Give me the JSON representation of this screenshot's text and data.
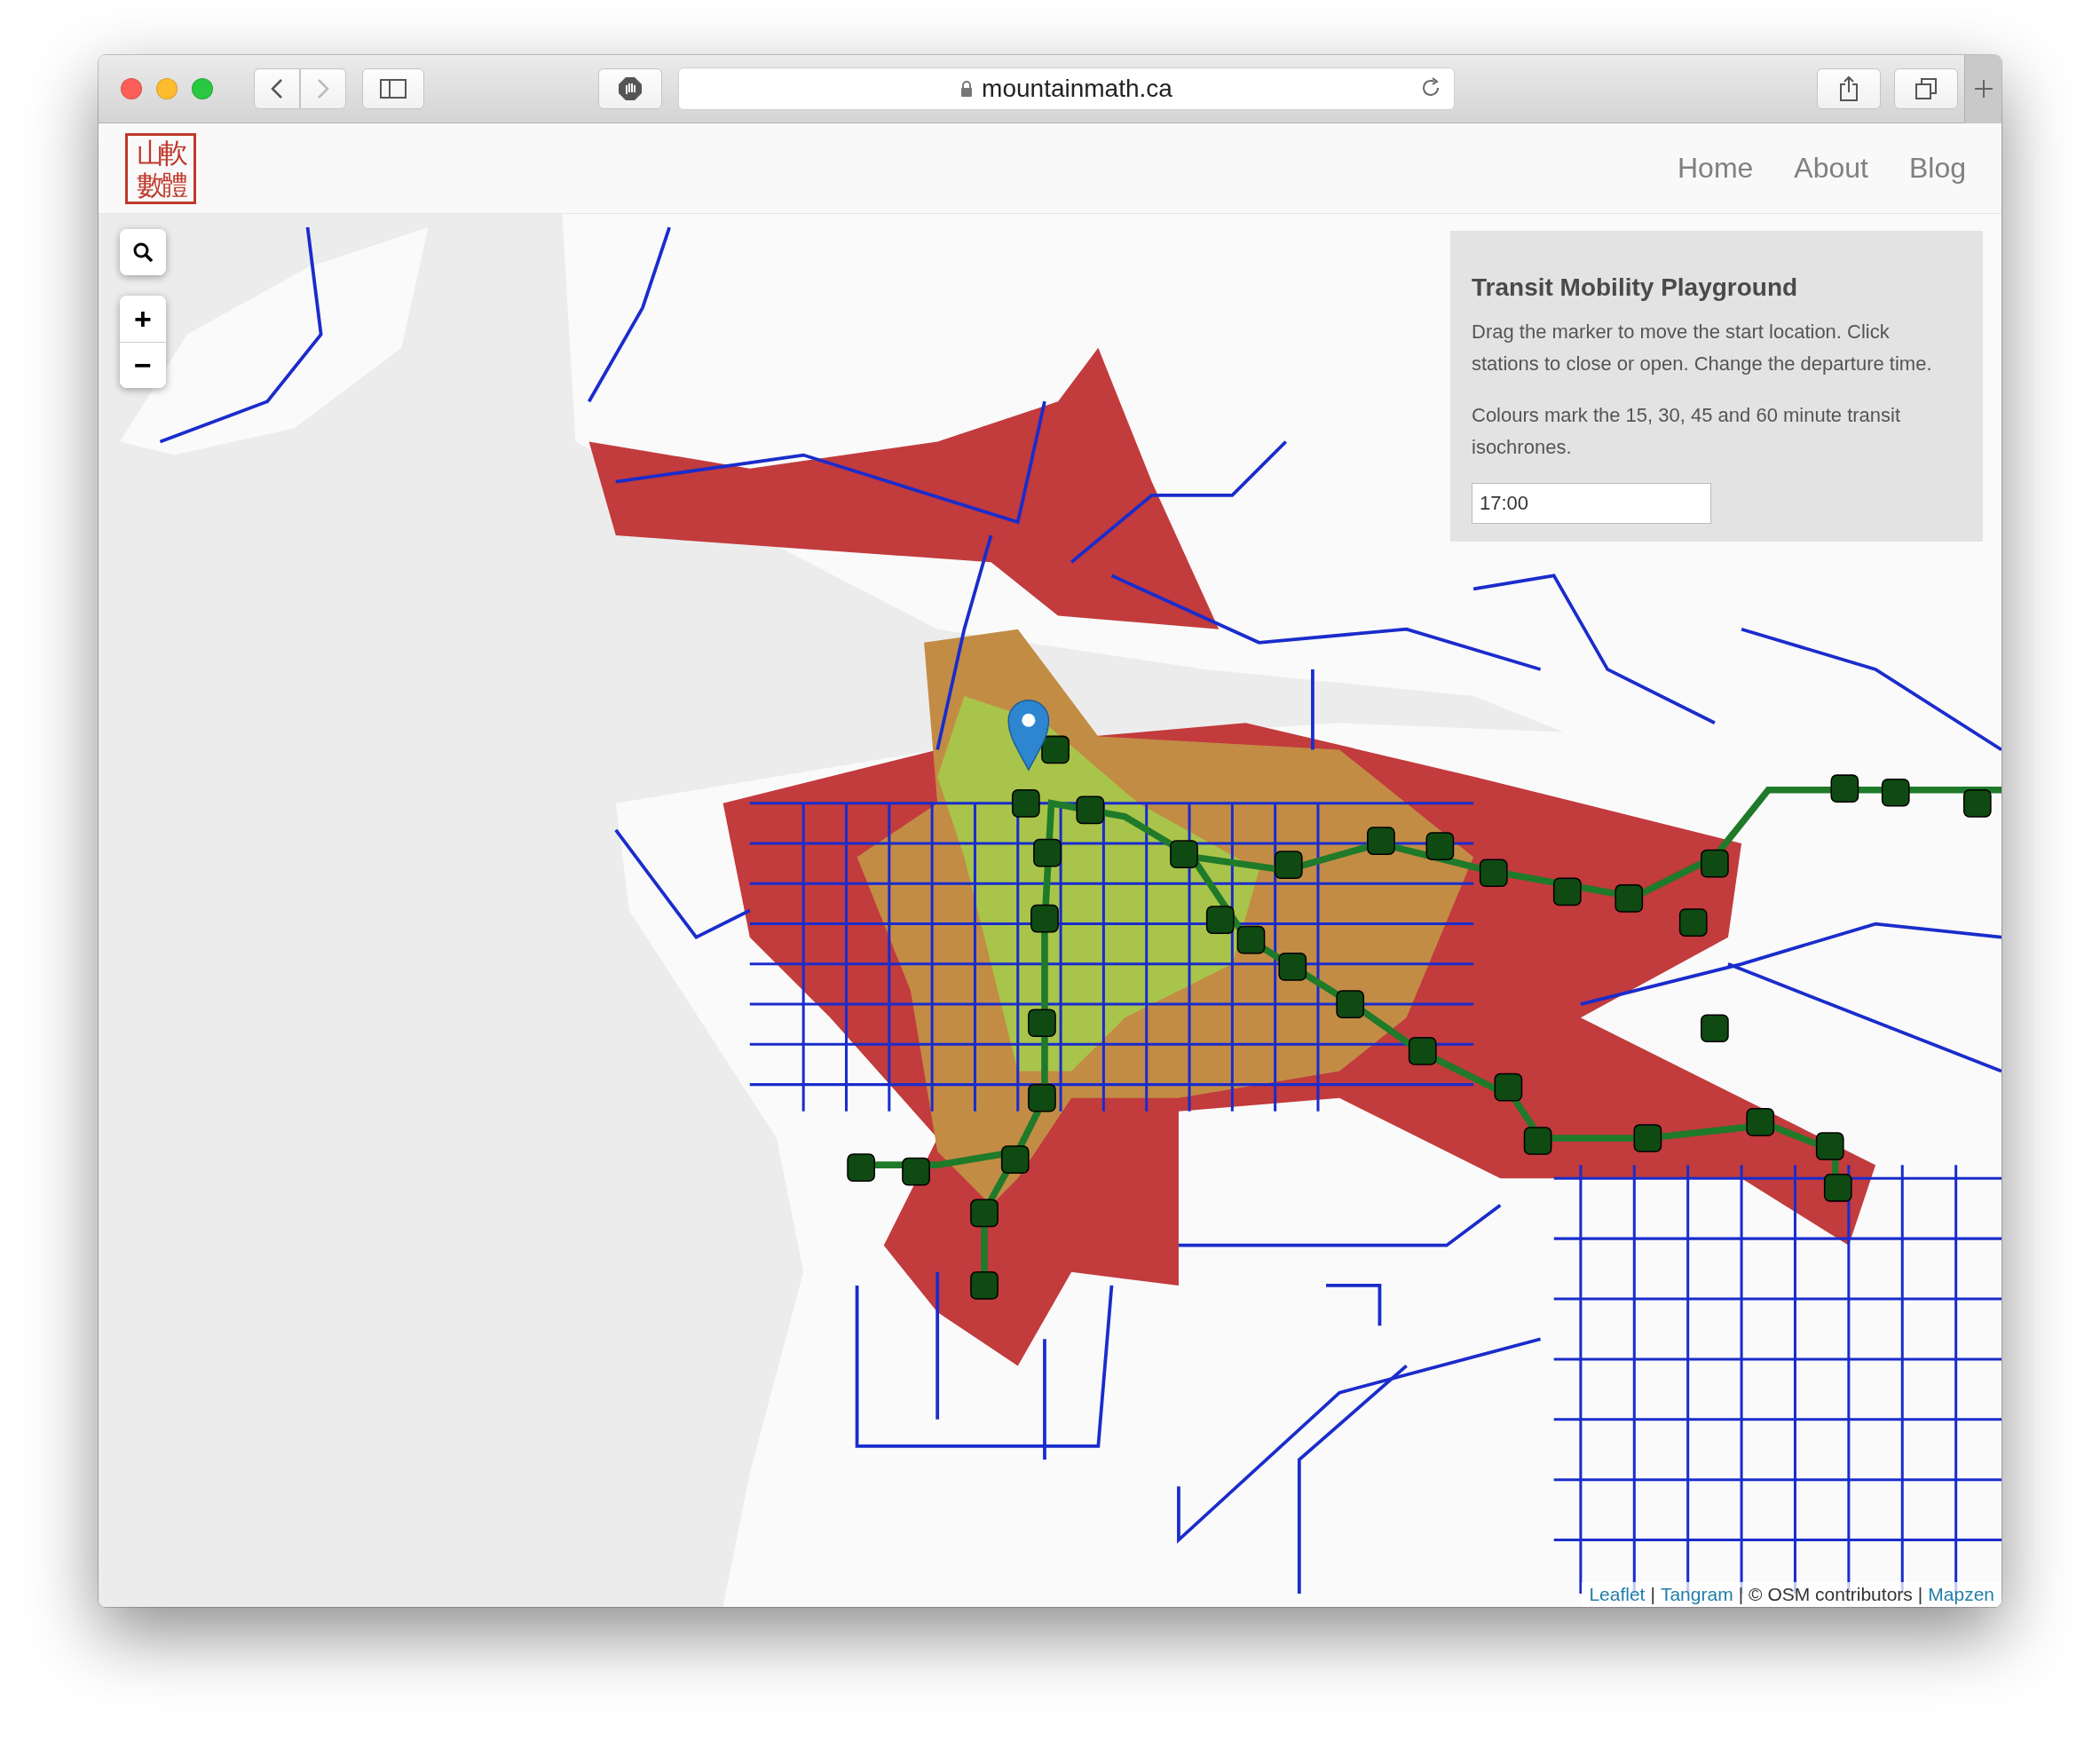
{
  "browser": {
    "url": "mountainmath.ca"
  },
  "header": {
    "logo": [
      "山軟",
      "數體"
    ],
    "nav": [
      {
        "label": "Home"
      },
      {
        "label": "About"
      },
      {
        "label": "Blog"
      }
    ]
  },
  "map": {
    "zoom_in": "+",
    "zoom_out": "−",
    "panel": {
      "title": "Transit Mobility Playground",
      "paragraphs": [
        "Drag the marker to move the start location. Click stations to close or open. Change the departure time.",
        "Colours mark the 15, 30, 45 and 60 minute transit isochrones."
      ],
      "time": "17:00"
    },
    "attribution": [
      {
        "kind": "link",
        "text": "Leaflet"
      },
      {
        "kind": "sep",
        "text": "|"
      },
      {
        "kind": "link",
        "text": "Tangram"
      },
      {
        "kind": "sep",
        "text": "|"
      },
      {
        "kind": "text",
        "text": "© OSM contributors"
      },
      {
        "kind": "sep",
        "text": "|"
      },
      {
        "kind": "link",
        "text": "Mapzen"
      }
    ]
  }
}
